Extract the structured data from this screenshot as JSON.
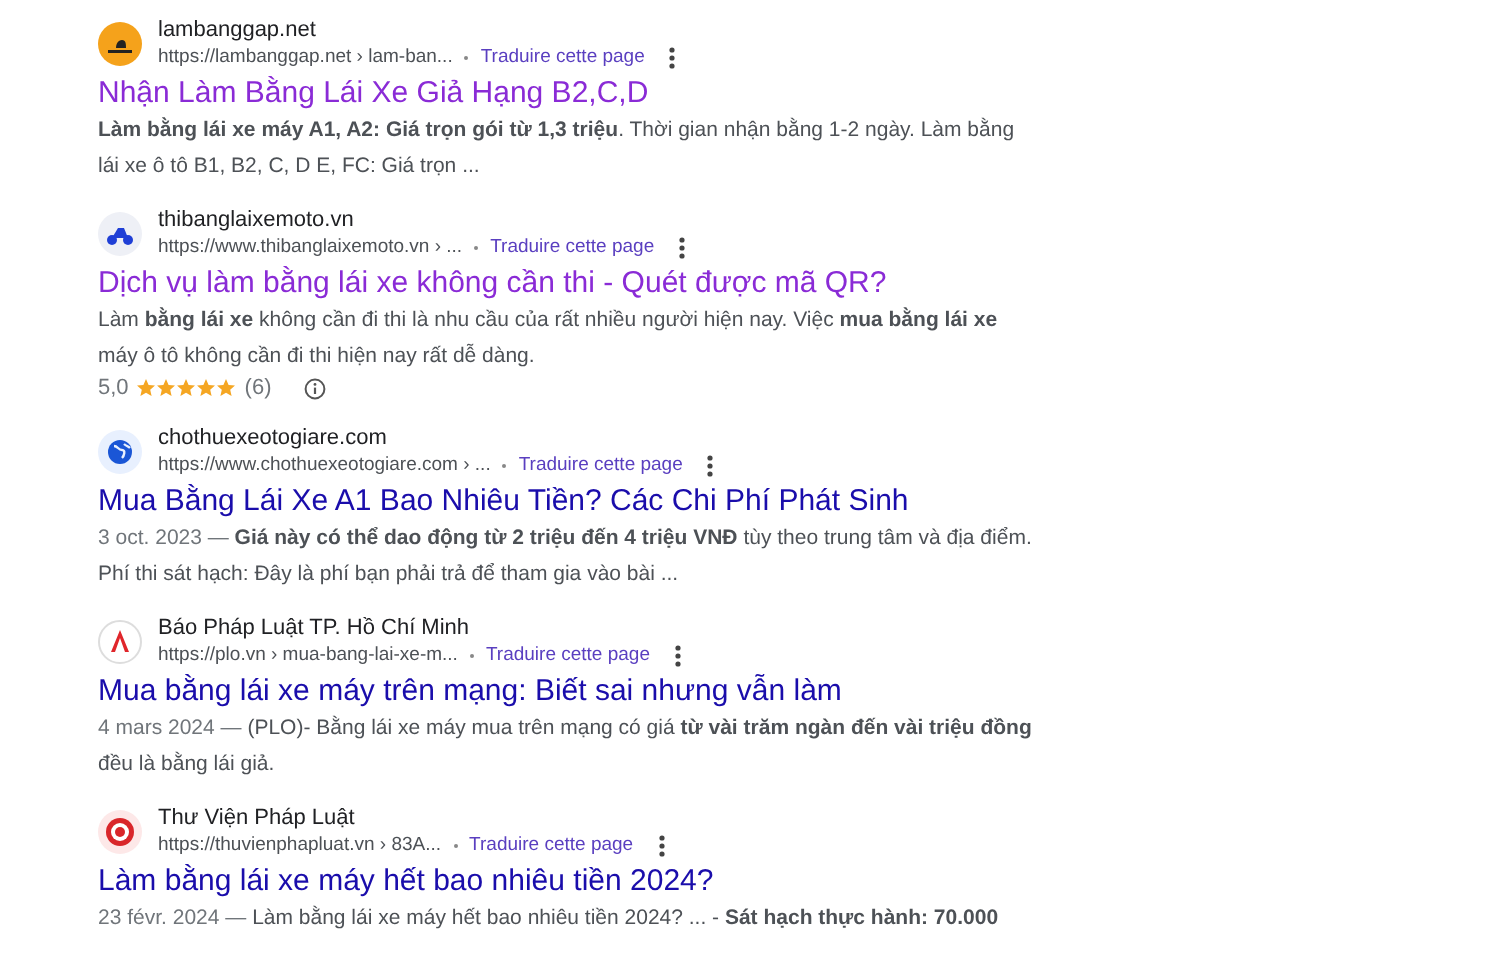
{
  "results": [
    {
      "site": "lambanggap.net",
      "url": "https://lambanggap.net › lam-ban...",
      "translate": "Traduire cette page",
      "title": "Nhận Làm Bằng Lái Xe Giả Hạng B2,C,D",
      "visited": true,
      "snippet": "**Làm bằng lái xe máy A1, A2: Giá trọn gói từ 1,3 triệu**. Thời gian nhận bằng 1-2 ngày. Làm bằng lái xe ô tô B1, B2, C, D E, FC: Giá trọn ..."
    },
    {
      "site": "thibanglaixemoto.vn",
      "url": "https://www.thibanglaixemoto.vn › ...",
      "translate": "Traduire cette page",
      "title": "Dịch vụ làm bằng lái xe không cần thi - Quét được mã QR?",
      "visited": true,
      "snippet": "Làm **bằng lái xe** không cần đi thi là nhu cầu của rất nhiều người hiện nay. Việc **mua bằng lái xe** máy ô tô không cần đi thi hiện nay rất dễ dàng.",
      "rating": {
        "score": "5,0",
        "stars": 5,
        "count": "(6)"
      }
    },
    {
      "site": "chothuexeotogiare.com",
      "url": "https://www.chothuexeotogiare.com › ...",
      "translate": "Traduire cette page",
      "title": "Mua Bằng Lái Xe A1 Bao Nhiêu Tiền? Các Chi Phí Phát Sinh",
      "visited": false,
      "date": "3 oct. 2023 —",
      "snippet": "**Giá này có thể dao động từ 2 triệu đến 4 triệu VNĐ** tùy theo trung tâm và địa điểm. Phí thi sát hạch: Đây là phí bạn phải trả để tham gia vào bài ..."
    },
    {
      "site": "Báo Pháp Luật TP. Hồ Chí Minh",
      "url": "https://plo.vn › mua-bang-lai-xe-m...",
      "translate": "Traduire cette page",
      "title": "Mua bằng lái xe máy trên mạng: Biết sai nhưng vẫn làm",
      "visited": false,
      "date": "4 mars 2024 —",
      "snippet": "(PLO)- Bằng lái xe máy mua trên mạng có giá **từ vài trăm ngàn đến vài triệu đồng** đều là bằng lái giả."
    },
    {
      "site": "Thư Viện Pháp Luật",
      "url": "https://thuvienphapluat.vn › 83A...",
      "translate": "Traduire cette page",
      "title": "Làm bằng lái xe máy hết bao nhiêu tiền 2024?",
      "visited": false,
      "date": "23 févr. 2024 —",
      "snippet": "Làm bằng lái xe máy hết bao nhiêu tiền 2024? ... - **Sát hạch thực hành: 70.000**"
    }
  ]
}
